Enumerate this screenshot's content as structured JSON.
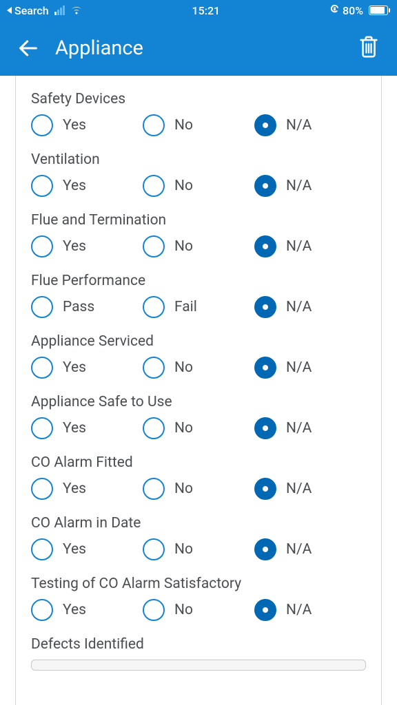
{
  "status": {
    "back_app": "Search",
    "time": "15:21",
    "battery": "80%"
  },
  "nav": {
    "title": "Appliance"
  },
  "sections": [
    {
      "title": "Safety Devices",
      "options": [
        "Yes",
        "No",
        "N/A"
      ],
      "selected": 2
    },
    {
      "title": "Ventilation",
      "options": [
        "Yes",
        "No",
        "N/A"
      ],
      "selected": 2
    },
    {
      "title": "Flue and Termination",
      "options": [
        "Yes",
        "No",
        "N/A"
      ],
      "selected": 2
    },
    {
      "title": "Flue Performance",
      "options": [
        "Pass",
        "Fail",
        "N/A"
      ],
      "selected": 2
    },
    {
      "title": "Appliance Serviced",
      "options": [
        "Yes",
        "No",
        "N/A"
      ],
      "selected": 2
    },
    {
      "title": "Appliance Safe to Use",
      "options": [
        "Yes",
        "No",
        "N/A"
      ],
      "selected": 2
    },
    {
      "title": "CO Alarm Fitted",
      "options": [
        "Yes",
        "No",
        "N/A"
      ],
      "selected": 2
    },
    {
      "title": "CO Alarm in Date",
      "options": [
        "Yes",
        "No",
        "N/A"
      ],
      "selected": 2
    },
    {
      "title": "Testing of CO Alarm Satisfactory",
      "options": [
        "Yes",
        "No",
        "N/A"
      ],
      "selected": 2
    }
  ],
  "defects": {
    "label": "Defects Identified"
  }
}
